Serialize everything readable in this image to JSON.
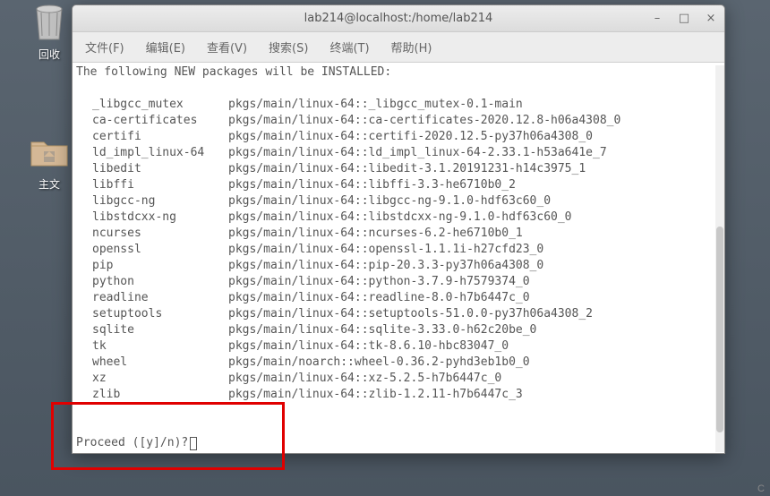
{
  "desktop": {
    "trash_label": "回收",
    "home_label": "主文"
  },
  "window": {
    "title": "lab214@localhost:/home/lab214",
    "controls": {
      "minimize": "–",
      "maximize": "□",
      "close": "×"
    }
  },
  "menubar": {
    "file": "文件(F)",
    "edit": "编辑(E)",
    "view": "查看(V)",
    "search": "搜索(S)",
    "terminal": "终端(T)",
    "help": "帮助(H)"
  },
  "terminal": {
    "header": "The following NEW packages will be INSTALLED:",
    "packages": [
      {
        "name": "_libgcc_mutex",
        "src": "pkgs/main/linux-64::_libgcc_mutex-0.1-main"
      },
      {
        "name": "ca-certificates",
        "src": "pkgs/main/linux-64::ca-certificates-2020.12.8-h06a4308_0"
      },
      {
        "name": "certifi",
        "src": "pkgs/main/linux-64::certifi-2020.12.5-py37h06a4308_0"
      },
      {
        "name": "ld_impl_linux-64",
        "src": "pkgs/main/linux-64::ld_impl_linux-64-2.33.1-h53a641e_7"
      },
      {
        "name": "libedit",
        "src": "pkgs/main/linux-64::libedit-3.1.20191231-h14c3975_1"
      },
      {
        "name": "libffi",
        "src": "pkgs/main/linux-64::libffi-3.3-he6710b0_2"
      },
      {
        "name": "libgcc-ng",
        "src": "pkgs/main/linux-64::libgcc-ng-9.1.0-hdf63c60_0"
      },
      {
        "name": "libstdcxx-ng",
        "src": "pkgs/main/linux-64::libstdcxx-ng-9.1.0-hdf63c60_0"
      },
      {
        "name": "ncurses",
        "src": "pkgs/main/linux-64::ncurses-6.2-he6710b0_1"
      },
      {
        "name": "openssl",
        "src": "pkgs/main/linux-64::openssl-1.1.1i-h27cfd23_0"
      },
      {
        "name": "pip",
        "src": "pkgs/main/linux-64::pip-20.3.3-py37h06a4308_0"
      },
      {
        "name": "python",
        "src": "pkgs/main/linux-64::python-3.7.9-h7579374_0"
      },
      {
        "name": "readline",
        "src": "pkgs/main/linux-64::readline-8.0-h7b6447c_0"
      },
      {
        "name": "setuptools",
        "src": "pkgs/main/linux-64::setuptools-51.0.0-py37h06a4308_2"
      },
      {
        "name": "sqlite",
        "src": "pkgs/main/linux-64::sqlite-3.33.0-h62c20be_0"
      },
      {
        "name": "tk",
        "src": "pkgs/main/linux-64::tk-8.6.10-hbc83047_0"
      },
      {
        "name": "wheel",
        "src": "pkgs/main/noarch::wheel-0.36.2-pyhd3eb1b0_0"
      },
      {
        "name": "xz",
        "src": "pkgs/main/linux-64::xz-5.2.5-h7b6447c_0"
      },
      {
        "name": "zlib",
        "src": "pkgs/main/linux-64::zlib-1.2.11-h7b6447c_3"
      }
    ],
    "prompt": "Proceed ([y]/n)? "
  },
  "status_char": "C"
}
